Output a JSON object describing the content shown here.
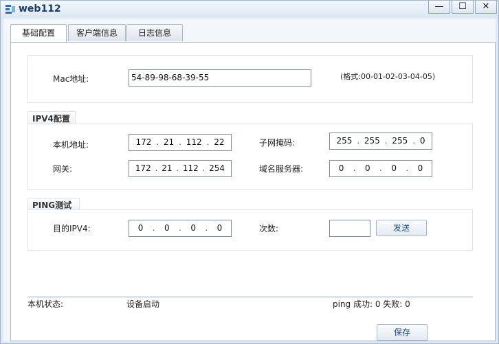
{
  "window": {
    "title": "web112",
    "minimize": "—",
    "maximize": "☐",
    "close": "✕"
  },
  "tabs": [
    {
      "label": "基础配置"
    },
    {
      "label": "客户端信息"
    },
    {
      "label": "日志信息"
    }
  ],
  "mac": {
    "label": "Mac地址:",
    "value": "54-89-98-68-39-55",
    "hint": "(格式:00-01-02-03-04-05)"
  },
  "ipv4": {
    "title": "IPV4配置",
    "local_label": "本机地址:",
    "local": [
      "172",
      "21",
      "112",
      "22"
    ],
    "mask_label": "子网掩码:",
    "mask": [
      "255",
      "255",
      "255",
      "0"
    ],
    "gateway_label": "网关:",
    "gateway": [
      "172",
      "21",
      "112",
      "254"
    ],
    "dns_label": "域名服务器:",
    "dns": [
      "0",
      "0",
      "0",
      "0"
    ]
  },
  "ping": {
    "title": "PING测试",
    "target_label": "目的IPV4:",
    "target": [
      "0",
      "0",
      "0",
      "0"
    ],
    "count_label": "次数:",
    "count": "",
    "send": "发送"
  },
  "status": {
    "label": "本机状态:",
    "value": "设备启动",
    "ping_result": "ping 成功: 0 失败: 0"
  },
  "save": "保存"
}
